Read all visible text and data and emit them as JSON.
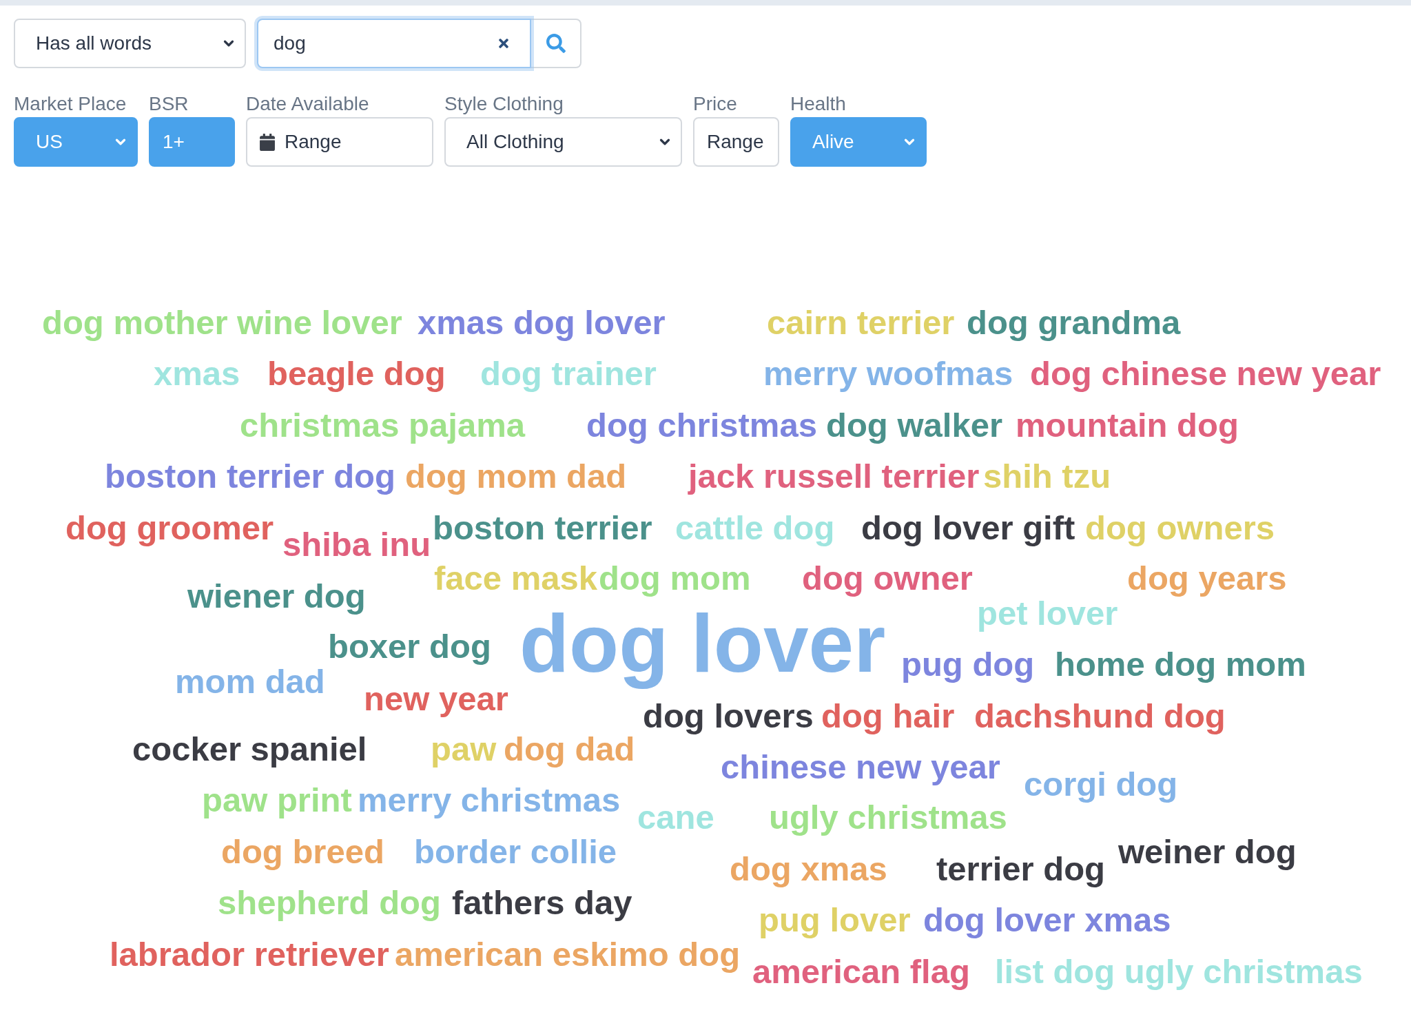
{
  "search": {
    "match_mode": "Has all words",
    "query": "dog",
    "focused": true
  },
  "filters": [
    {
      "label": "Market Place",
      "kind": "select",
      "value": "US",
      "active": true
    },
    {
      "label": "BSR",
      "kind": "input",
      "value": "1+",
      "active": true
    },
    {
      "label": "Date Available",
      "kind": "date",
      "value": "Range",
      "active": false
    },
    {
      "label": "Style Clothing",
      "kind": "select",
      "value": "All Clothing",
      "active": false
    },
    {
      "label": "Price",
      "kind": "input",
      "value": "Range",
      "active": false
    },
    {
      "label": "Health",
      "kind": "select",
      "value": "Alive",
      "active": true
    }
  ],
  "word_cloud": {
    "words": [
      {
        "text": "dog mother wine lover",
        "color": "#9fe28a",
        "kind": "term"
      },
      {
        "text": "xmas dog lover",
        "color": "#7d85de",
        "kind": "term"
      },
      {
        "text": "cairn terrier",
        "color": "#dfd166",
        "kind": "term"
      },
      {
        "text": "dog grandma",
        "color": "#4b918b",
        "kind": "term"
      },
      {
        "text": "xmas",
        "color": "#9fe5df",
        "kind": "term"
      },
      {
        "text": "beagle dog",
        "color": "#e0625e",
        "kind": "term"
      },
      {
        "text": "dog trainer",
        "color": "#9fe5df",
        "kind": "term"
      },
      {
        "text": "merry woofmas",
        "color": "#84b4e8",
        "kind": "term"
      },
      {
        "text": "dog chinese new year",
        "color": "#e0617e",
        "kind": "term"
      },
      {
        "text": "christmas pajama",
        "color": "#9fe28a",
        "kind": "term"
      },
      {
        "text": "dog christmas",
        "color": "#7d85de",
        "kind": "term"
      },
      {
        "text": "dog walker",
        "color": "#4b918b",
        "kind": "term"
      },
      {
        "text": "mountain dog",
        "color": "#e0617e",
        "kind": "term"
      },
      {
        "text": "boston terrier dog",
        "color": "#7d85de",
        "kind": "term"
      },
      {
        "text": "dog mom dad",
        "color": "#eba663",
        "kind": "term"
      },
      {
        "text": "jack russell terrier",
        "color": "#e0617e",
        "kind": "term"
      },
      {
        "text": "shih tzu",
        "color": "#dfd166",
        "kind": "term"
      },
      {
        "text": "dog groomer",
        "color": "#e0625e",
        "kind": "term"
      },
      {
        "text": "shiba inu",
        "color": "#e0617e",
        "kind": "term"
      },
      {
        "text": "boston terrier",
        "color": "#4b918b",
        "kind": "term"
      },
      {
        "text": "cattle dog",
        "color": "#9fe5df",
        "kind": "term"
      },
      {
        "text": "dog lover gift",
        "color": "#3b3c44",
        "kind": "term"
      },
      {
        "text": "dog owners",
        "color": "#dfd166",
        "kind": "term"
      },
      {
        "text": "wiener dog",
        "color": "#4b918b",
        "kind": "term"
      },
      {
        "text": "face mask",
        "color": "#dfd166",
        "kind": "term"
      },
      {
        "text": "dog mom",
        "color": "#9fe28a",
        "kind": "term"
      },
      {
        "text": "dog owner",
        "color": "#e0617e",
        "kind": "term"
      },
      {
        "text": "dog years",
        "color": "#eba663",
        "kind": "term"
      },
      {
        "text": "boxer dog",
        "color": "#4b918b",
        "kind": "term"
      },
      {
        "text": "pet lover",
        "color": "#9fe5df",
        "kind": "term"
      },
      {
        "text": "dog lover",
        "color": "#84b4e8",
        "kind": "top"
      },
      {
        "text": "pug dog",
        "color": "#7d85de",
        "kind": "term"
      },
      {
        "text": "home dog mom",
        "color": "#4b918b",
        "kind": "term"
      },
      {
        "text": "mom dad",
        "color": "#84b4e8",
        "kind": "term"
      },
      {
        "text": "new year",
        "color": "#e0625e",
        "kind": "term"
      },
      {
        "text": "dog lovers",
        "color": "#3b3c44",
        "kind": "term"
      },
      {
        "text": "dog hair",
        "color": "#e0625e",
        "kind": "term"
      },
      {
        "text": "dachshund dog",
        "color": "#e0625e",
        "kind": "term"
      },
      {
        "text": "cocker spaniel",
        "color": "#3b3c44",
        "kind": "term"
      },
      {
        "text": "paw",
        "color": "#dfd166",
        "kind": "term"
      },
      {
        "text": "dog dad",
        "color": "#eba663",
        "kind": "term"
      },
      {
        "text": "chinese new year",
        "color": "#7d85de",
        "kind": "term"
      },
      {
        "text": "corgi dog",
        "color": "#84b4e8",
        "kind": "term"
      },
      {
        "text": "paw print",
        "color": "#9fe28a",
        "kind": "term"
      },
      {
        "text": "merry christmas",
        "color": "#84b4e8",
        "kind": "term"
      },
      {
        "text": "cane",
        "color": "#9fe5df",
        "kind": "term"
      },
      {
        "text": "ugly christmas",
        "color": "#9fe28a",
        "kind": "term"
      },
      {
        "text": "dog breed",
        "color": "#eba663",
        "kind": "term"
      },
      {
        "text": "border collie",
        "color": "#84b4e8",
        "kind": "term"
      },
      {
        "text": "dog xmas",
        "color": "#eba663",
        "kind": "term"
      },
      {
        "text": "terrier dog",
        "color": "#3b3c44",
        "kind": "term"
      },
      {
        "text": "weiner dog",
        "color": "#3b3c44",
        "kind": "term"
      },
      {
        "text": "shepherd dog",
        "color": "#9fe28a",
        "kind": "term"
      },
      {
        "text": "fathers day",
        "color": "#3b3c44",
        "kind": "term"
      },
      {
        "text": "pug lover",
        "color": "#dfd166",
        "kind": "term"
      },
      {
        "text": "dog lover xmas",
        "color": "#7d85de",
        "kind": "term"
      },
      {
        "text": "labrador retriever",
        "color": "#e0625e",
        "kind": "term"
      },
      {
        "text": "american eskimo dog",
        "color": "#eba663",
        "kind": "term"
      },
      {
        "text": "american flag",
        "color": "#e0617e",
        "kind": "term"
      },
      {
        "text": "list dog ugly christmas",
        "color": "#9fe5df",
        "kind": "term"
      }
    ]
  }
}
